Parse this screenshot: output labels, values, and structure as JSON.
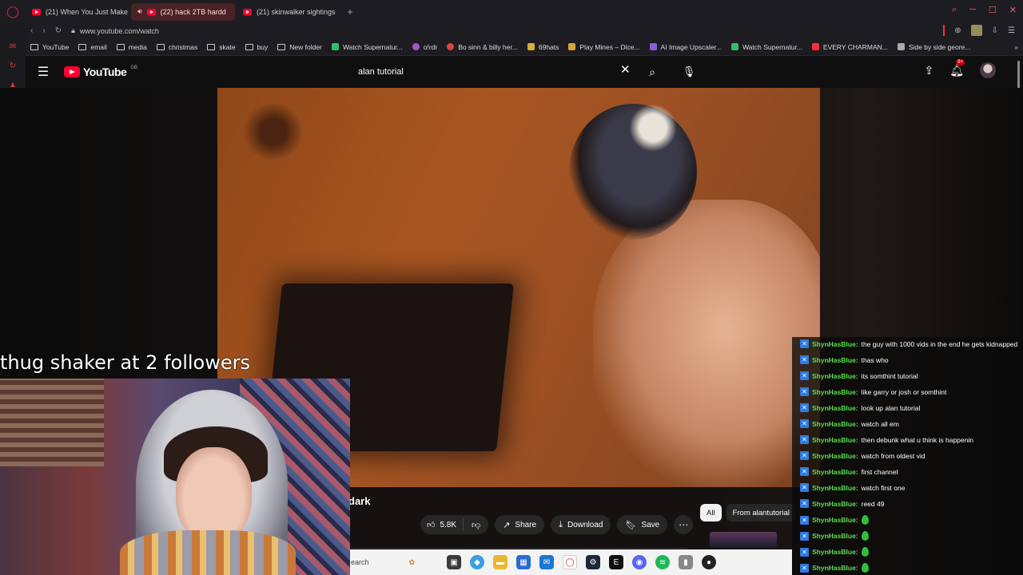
{
  "browser": {
    "tabs": [
      {
        "label": "(21) When You Just Make",
        "active": false,
        "audio": false
      },
      {
        "label": "(22) hack 2TB hardd",
        "active": true,
        "audio": true
      },
      {
        "label": "(21) skinwalker sightings",
        "active": false,
        "audio": false
      }
    ],
    "url": "www.youtube.com/watch",
    "bookmarks": [
      {
        "label": "YouTube",
        "type": "folder"
      },
      {
        "label": "email",
        "type": "folder"
      },
      {
        "label": "media",
        "type": "folder"
      },
      {
        "label": "christmas",
        "type": "folder"
      },
      {
        "label": "skate",
        "type": "folder"
      },
      {
        "label": "buy",
        "type": "folder"
      },
      {
        "label": "New folder",
        "type": "folder"
      },
      {
        "label": "Watch Supernatur...",
        "type": "site",
        "color": "#2fbf6a"
      },
      {
        "label": "o!rdr",
        "type": "site",
        "color": "#b04fd6"
      },
      {
        "label": "Bo sinn & billy her...",
        "type": "site",
        "color": "#e04040"
      },
      {
        "label": "69hats",
        "type": "site",
        "color": "#d6b13a"
      },
      {
        "label": "Play Mines – Dice...",
        "type": "site",
        "color": "#d6a23a"
      },
      {
        "label": "AI Image Upscaler...",
        "type": "site",
        "color": "#8a5ae0"
      },
      {
        "label": "Watch Supernatur...",
        "type": "site",
        "color": "#2fbf6a"
      },
      {
        "label": "EVERY CHARMAN...",
        "type": "site",
        "color": "#ff2d2d"
      },
      {
        "label": "Side by side geore...",
        "type": "site",
        "color": "#aaaaaa"
      }
    ]
  },
  "youtube": {
    "logo_text": "YouTube",
    "region": "GB",
    "search_value": "alan tutorial",
    "notification_count": "9+",
    "video_title_fragment": "dark",
    "likes": "5.8K",
    "share_label": "Share",
    "download_label": "Download",
    "save_label": "Save",
    "chips": [
      {
        "label": "All",
        "selected": true
      },
      {
        "label": "From alantutorial",
        "selected": false
      }
    ]
  },
  "taskbar": {
    "search_placeholder": "earch"
  },
  "stream": {
    "overlay_text": "thug shaker at 2 followers",
    "chat_user": "ShynHasBlue:",
    "chat": [
      {
        "user": "ShynHasBlue:",
        "text": "the guy with 1000 vids in the end he gets kidnapped"
      },
      {
        "user": "ShynHasBlue:",
        "text": "thas who"
      },
      {
        "user": "ShynHasBlue:",
        "text": "its somthint tutorial"
      },
      {
        "user": "ShynHasBlue:",
        "text": "like garry or josh or somthint"
      },
      {
        "user": "ShynHasBlue:",
        "text": "look up alan tutorial"
      },
      {
        "user": "ShynHasBlue:",
        "text": "watch all em"
      },
      {
        "user": "ShynHasBlue:",
        "text": "then debunk what u think is happenin"
      },
      {
        "user": "ShynHasBlue:",
        "text": "watch from oldest vid"
      },
      {
        "user": "ShynHasBlue:",
        "text": "first channel"
      },
      {
        "user": "ShynHasBlue:",
        "text": "watch first one"
      },
      {
        "user": "ShynHasBlue:",
        "text": "reed 49"
      },
      {
        "user": "ShynHasBlue:",
        "text": ""
      },
      {
        "user": "ShynHasBlue:",
        "text": ""
      },
      {
        "user": "ShynHasBlue:",
        "text": ""
      },
      {
        "user": "ShynHasBlue:",
        "text": ""
      }
    ]
  }
}
